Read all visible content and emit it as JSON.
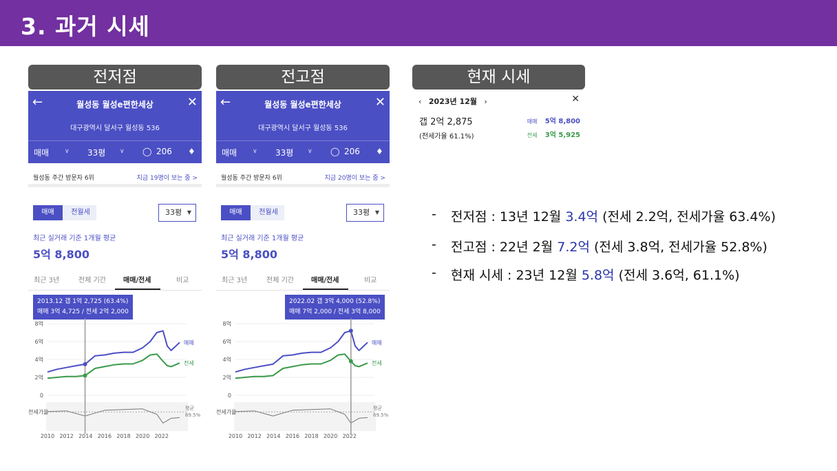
{
  "slide": {
    "title": "3. 과거 시세"
  },
  "captions": {
    "low": "전저점",
    "high": "전고점",
    "current": "현재 시세"
  },
  "app": {
    "title": "월성동 월성e편한세상",
    "address": "대구광역시 달서구 월성동 536",
    "trade_select": "매매",
    "size_select": "33평",
    "comment_count": "206",
    "visit_rank": "월성동 주간 방문자 6위",
    "toggle_sale": "매매",
    "toggle_rent": "전월세",
    "size_dropdown": "33평",
    "avg_caption": "최근 실거래 기준 1개월 평균",
    "avg_price": "5억 8,800",
    "tabs": [
      "최근 3년",
      "전체 기간",
      "매매/전세",
      "비교"
    ],
    "active_tab_index": 2,
    "legend_sale": "매매",
    "legend_rent": "전세",
    "ratio_label": "전세가율",
    "avg_label": "평균",
    "avg_ratio": "69.5%",
    "y_ticks": [
      "8억",
      "6억",
      "4억",
      "2억",
      "0"
    ],
    "x_ticks": [
      "2010",
      "2012",
      "2014",
      "2016",
      "2018",
      "2020",
      "2022"
    ],
    "colors": {
      "sale": "#4b4fc4",
      "rent": "#3a9a4a",
      "ratio": "#777777"
    }
  },
  "low_shot": {
    "visitors_now": "지금 19명이 보는 중 >",
    "tooltip_line1": "2013.12  갭 1억 2,725 (63.4%)",
    "tooltip_line2": "매매 3억 4,725 / 전세 2억 2,000"
  },
  "high_shot": {
    "visitors_now": "지금 20명이 보는 중 >",
    "tooltip_line1": "2022.02  갭 3억 4,000 (52.8%)",
    "tooltip_line2": "매매 7억 2,000 / 전세 3억 8,000"
  },
  "current": {
    "month": "2023년 12월",
    "gap": "갭 2억 2,875",
    "ratio": "(전세가율 61.1%)",
    "sale_label": "매매",
    "sale_value": "5억 8,800",
    "rent_label": "전세",
    "rent_value": "3억 5,925"
  },
  "notes": [
    {
      "pre": "전저점 : 13년 12월 ",
      "hl": "3.4억",
      "post": " (전세 2.2억, 전세가율 63.4%)"
    },
    {
      "pre": "전고점 : 22년 2월 ",
      "hl": "7.2억",
      "post": " (전세 3.8억, 전세가율 52.8%)"
    },
    {
      "pre": "현재 시세 : 23년 12월 ",
      "hl": "5.8억",
      "post": " (전세 3.6억,  61.1%)"
    }
  ],
  "chart_data": {
    "type": "line",
    "x_range": [
      2010,
      2023.9
    ],
    "ylim": [
      0,
      8
    ],
    "y_unit": "억",
    "series": [
      {
        "name": "매매",
        "x": [
          2010,
          2011,
          2012,
          2013,
          2013.95,
          2015,
          2016,
          2017,
          2018,
          2019,
          2020,
          2020.8,
          2021.5,
          2022.15,
          2022.6,
          2023,
          2023.9
        ],
        "values": [
          2.6,
          2.9,
          3.1,
          3.3,
          3.47,
          4.4,
          4.5,
          4.7,
          4.8,
          4.8,
          5.3,
          6.0,
          7.0,
          7.2,
          5.5,
          5.0,
          5.9
        ]
      },
      {
        "name": "전세",
        "x": [
          2010,
          2011,
          2012,
          2013,
          2013.95,
          2015,
          2016,
          2017,
          2018,
          2019,
          2020,
          2020.8,
          2021.5,
          2022.15,
          2022.6,
          2023,
          2023.9
        ],
        "values": [
          1.9,
          2.0,
          2.1,
          2.1,
          2.2,
          3.0,
          3.2,
          3.4,
          3.5,
          3.5,
          3.9,
          4.5,
          4.6,
          3.8,
          3.3,
          3.2,
          3.6
        ]
      },
      {
        "name": "전세가율",
        "x": [
          2010,
          2012,
          2013.95,
          2016,
          2018,
          2020,
          2021.5,
          2022.15,
          2023,
          2023.9
        ],
        "values": [
          70,
          71,
          63.4,
          72,
          73,
          74,
          66,
          52.8,
          60,
          61.1
        ]
      }
    ],
    "markers": {
      "low": 2013.95,
      "high": 2022.15
    }
  }
}
